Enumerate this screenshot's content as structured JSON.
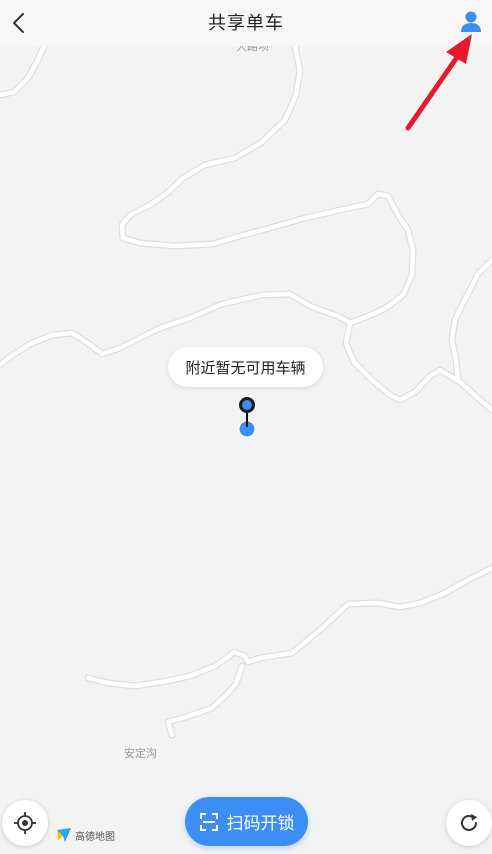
{
  "header": {
    "title": "共享单车",
    "back_icon": "chevron-left-icon",
    "user_icon": "user-icon",
    "accent_color": "#3d8ef4"
  },
  "map": {
    "place_labels": [
      "大路坝",
      "安定沟"
    ],
    "tooltip": "附近暂无可用车辆",
    "provider_logo_text": "高德地图"
  },
  "controls": {
    "locate_icon": "crosshair-icon",
    "scan_label": "扫码开锁",
    "scan_icon": "scan-frame-icon",
    "refresh_icon": "refresh-icon"
  },
  "annotation": {
    "arrow_color": "#e8192c",
    "arrow_icon": "red-arrow-pointer"
  }
}
